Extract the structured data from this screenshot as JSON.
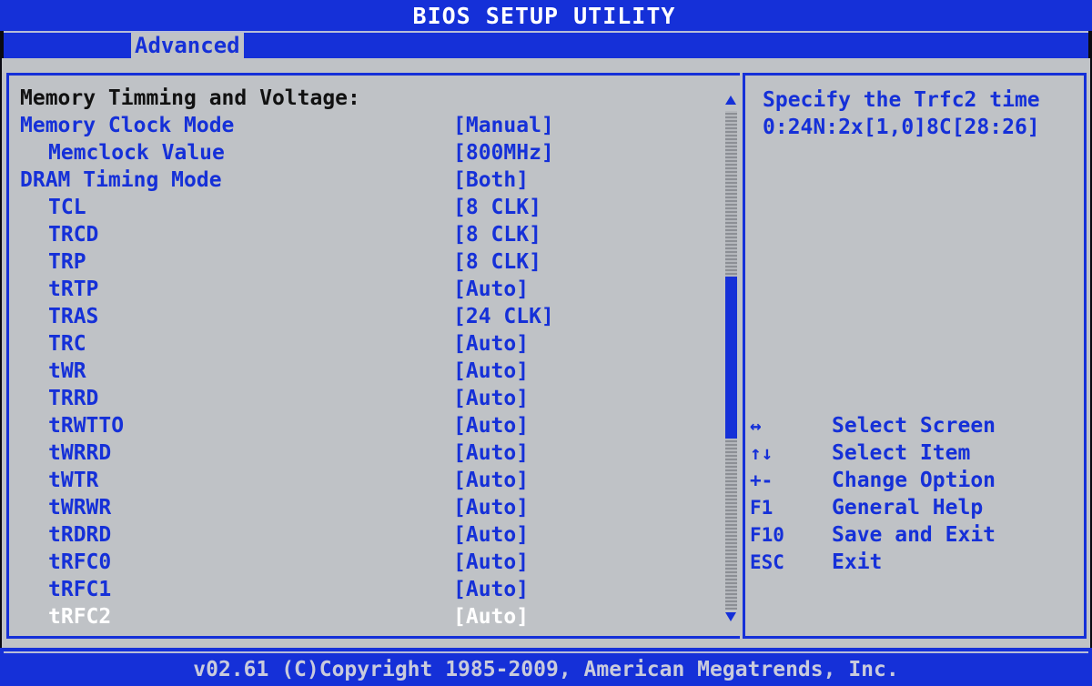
{
  "app": {
    "title": "BIOS SETUP UTILITY",
    "active_tab": "Advanced"
  },
  "section": {
    "title": "Memory Timming and Voltage:"
  },
  "settings": [
    {
      "label": "Memory Clock Mode",
      "value": "[Manual]",
      "indent": 0
    },
    {
      "label": "Memclock Value",
      "value": "[800MHz]",
      "indent": 1
    },
    {
      "label": "DRAM Timing Mode",
      "value": "[Both]",
      "indent": 0
    },
    {
      "label": "TCL",
      "value": "[8 CLK]",
      "indent": 1
    },
    {
      "label": "TRCD",
      "value": "[8 CLK]",
      "indent": 1
    },
    {
      "label": "TRP",
      "value": "[8 CLK]",
      "indent": 1
    },
    {
      "label": "tRTP",
      "value": "[Auto]",
      "indent": 1
    },
    {
      "label": "TRAS",
      "value": "[24 CLK]",
      "indent": 1
    },
    {
      "label": "TRC",
      "value": "[Auto]",
      "indent": 1
    },
    {
      "label": "tWR",
      "value": "[Auto]",
      "indent": 1
    },
    {
      "label": "TRRD",
      "value": "[Auto]",
      "indent": 1
    },
    {
      "label": "tRWTTO",
      "value": "[Auto]",
      "indent": 1
    },
    {
      "label": "tWRRD",
      "value": "[Auto]",
      "indent": 1
    },
    {
      "label": "tWTR",
      "value": "[Auto]",
      "indent": 1
    },
    {
      "label": "tWRWR",
      "value": "[Auto]",
      "indent": 1
    },
    {
      "label": "tRDRD",
      "value": "[Auto]",
      "indent": 1
    },
    {
      "label": "tRFC0",
      "value": "[Auto]",
      "indent": 1
    },
    {
      "label": "tRFC1",
      "value": "[Auto]",
      "indent": 1
    },
    {
      "label": "tRFC2",
      "value": "[Auto]",
      "indent": 1,
      "selected": true
    }
  ],
  "help": {
    "line1": "Specify the Trfc2 time",
    "line2": "0:24N:2x[1,0]8C[28:26]"
  },
  "keys": [
    {
      "glyph": "↔",
      "icon": "left-right-arrows-icon",
      "desc": "Select Screen"
    },
    {
      "glyph": "↑↓",
      "icon": "up-down-arrows-icon",
      "desc": "Select Item"
    },
    {
      "glyph": "+-",
      "icon": "plus-minus-icon",
      "desc": "Change Option"
    },
    {
      "glyph": "F1",
      "icon": "",
      "desc": "General Help"
    },
    {
      "glyph": "F10",
      "icon": "",
      "desc": "Save and Exit"
    },
    {
      "glyph": "ESC",
      "icon": "",
      "desc": "Exit"
    }
  ],
  "footer": {
    "copyright": "v02.61 (C)Copyright 1985-2009, American Megatrends, Inc."
  },
  "colors": {
    "bios_blue": "#1530d8",
    "panel_gray": "#bfc2c6",
    "highlight": "#ffffff"
  },
  "scrollbar": {
    "thumb_position_fraction": 0.33,
    "thumb_size_fraction": 0.32
  }
}
